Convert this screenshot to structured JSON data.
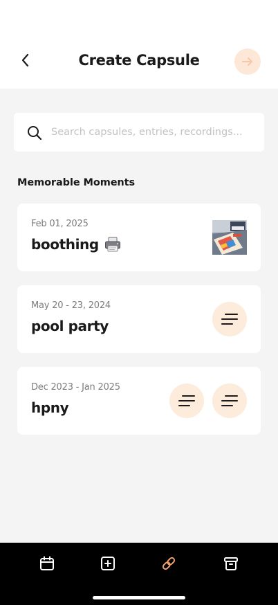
{
  "header": {
    "title": "Create Capsule"
  },
  "search": {
    "placeholder": "Search capsules, entries, recordings..."
  },
  "section": {
    "title": "Memorable Moments"
  },
  "cards": [
    {
      "date": "Feb 01, 2025",
      "name": "boothing",
      "media": "photo-thumbnail"
    },
    {
      "date": "May 20 - 23, 2024",
      "name": "pool party",
      "media": "text-lines-icon"
    },
    {
      "date": "Dec 2023 - Jan 2025",
      "name": "hpny",
      "media": "text-lines-icon x2"
    }
  ],
  "tabbar": {
    "items": [
      "calendar-icon",
      "add-square-icon",
      "link-icon",
      "archive-box-icon"
    ],
    "active_index": 2
  },
  "colors": {
    "accent": "#f0a26a",
    "accent_light": "#fdebdc",
    "background": "#f4f4f4",
    "tabbar": "#000000"
  }
}
